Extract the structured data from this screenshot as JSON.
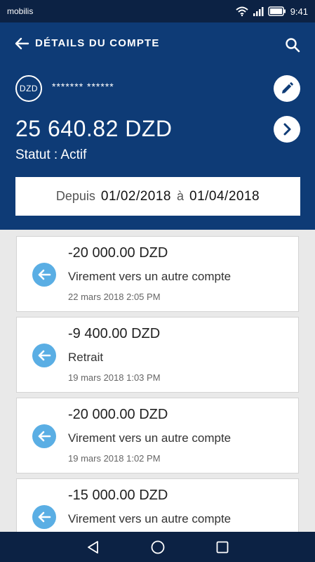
{
  "status_bar": {
    "carrier": "mobilis",
    "time": "9:41"
  },
  "toolbar": {
    "title": "DÉTAILS DU COMPTE",
    "back_icon": "arrow-left-icon",
    "search_icon": "search-icon"
  },
  "account": {
    "currency_badge": "DZD",
    "masked_number": "******* ******",
    "balance": "25 640.82  DZD",
    "status": "Statut : Actif"
  },
  "date_range": {
    "from_label": "Depuis",
    "from_date": "01/02/2018",
    "to_label": "à",
    "to_date": "01/04/2018"
  },
  "transactions": [
    {
      "amount": "-20 000.00 DZD",
      "label": "Virement vers un autre compte",
      "date": "22 mars 2018 2:05 PM"
    },
    {
      "amount": "-9 400.00 DZD",
      "label": "Retrait",
      "date": "19 mars 2018 1:03 PM"
    },
    {
      "amount": "-20 000.00 DZD",
      "label": "Virement vers un autre compte",
      "date": "19 mars 2018 1:02 PM"
    },
    {
      "amount": "-15 000.00 DZD",
      "label": "Virement vers un autre compte",
      "date": ""
    }
  ],
  "colors": {
    "header": "#0e3b76",
    "status_bar": "#0c2244",
    "accent_icon": "#5aaee4",
    "background": "#e9e9e9"
  }
}
